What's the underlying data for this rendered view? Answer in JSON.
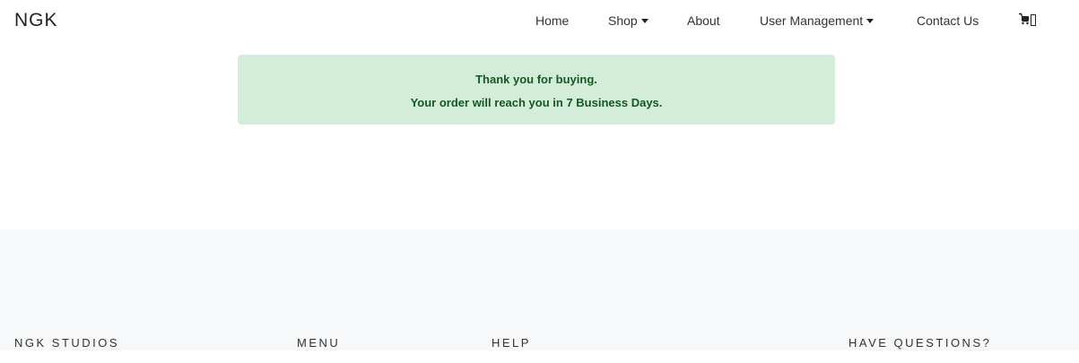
{
  "navbar": {
    "brand": "NGK",
    "items": [
      {
        "label": "Home"
      },
      {
        "label": "Shop"
      },
      {
        "label": "About"
      },
      {
        "label": "User Management"
      },
      {
        "label": "Contact Us"
      }
    ],
    "cart_icon": "cart-icon"
  },
  "alert": {
    "line1": "Thank you for buying.",
    "line2": "Your order will reach you in 7 Business Days.",
    "background": "#d4edda",
    "text_color": "#155724"
  },
  "footer": {
    "headings": [
      "NGK STUDIOS",
      "MENU",
      "HELP",
      "HAVE QUESTIONS?"
    ],
    "background": "#f7f8f9"
  }
}
